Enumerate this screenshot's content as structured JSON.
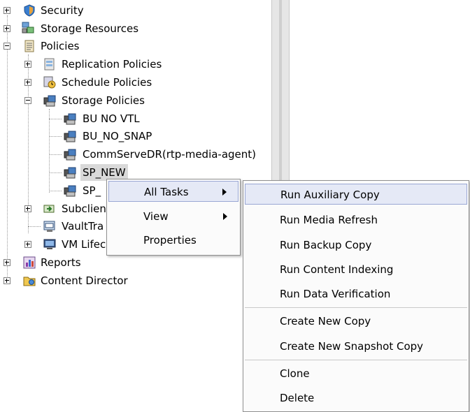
{
  "tree": {
    "items": [
      {
        "label": "Security",
        "icon": "shield-icon"
      },
      {
        "label": "Storage Resources",
        "icon": "storage-resources-icon"
      },
      {
        "label": "Policies",
        "icon": "policies-icon"
      },
      {
        "label": "Replication Policies",
        "icon": "replication-policy-icon"
      },
      {
        "label": "Schedule Policies",
        "icon": "schedule-policy-icon"
      },
      {
        "label": "Storage Policies",
        "icon": "storage-policy-icon"
      },
      {
        "label": "BU NO VTL",
        "icon": "storage-policy-icon"
      },
      {
        "label": "BU_NO_SNAP",
        "icon": "storage-policy-icon"
      },
      {
        "label": "CommServeDR(rtp-media-agent)",
        "icon": "storage-policy-icon"
      },
      {
        "label": "SP_NEW",
        "icon": "storage-policy-icon"
      },
      {
        "label": "SP_",
        "icon": "storage-policy-icon"
      },
      {
        "label": "Subclien",
        "icon": "subclient-policy-icon"
      },
      {
        "label": "VaultTra",
        "icon": "vault-tracker-icon"
      },
      {
        "label": "VM Lifec",
        "icon": "vm-lifecycle-icon"
      },
      {
        "label": "Reports",
        "icon": "reports-icon"
      },
      {
        "label": "Content Director",
        "icon": "content-director-icon"
      }
    ]
  },
  "context_menu": {
    "items": [
      {
        "label": "All Tasks",
        "submenu": true
      },
      {
        "label": "View",
        "submenu": true
      },
      {
        "label": "Properties",
        "submenu": false
      }
    ]
  },
  "submenu": {
    "items": [
      {
        "label": "Run Auxiliary Copy"
      },
      {
        "label": "Run Media Refresh"
      },
      {
        "label": "Run Backup Copy"
      },
      {
        "label": "Run Content Indexing"
      },
      {
        "label": "Run Data Verification"
      },
      {
        "label": "Create New Copy"
      },
      {
        "label": "Create New Snapshot Copy"
      },
      {
        "label": "Clone"
      },
      {
        "label": "Delete"
      }
    ]
  },
  "colors": {
    "highlight": "#e5e9f6",
    "selected_node": "#d9d9d9"
  }
}
